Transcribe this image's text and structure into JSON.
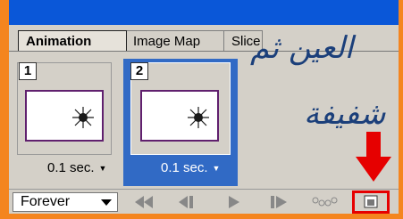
{
  "tabs": [
    "Animation",
    "Image Map",
    "Slice"
  ],
  "frames": [
    {
      "number": "1",
      "delay": "0.1 sec."
    },
    {
      "number": "2",
      "delay": "0.1 sec."
    }
  ],
  "loop": {
    "value": "Forever"
  },
  "annotation": {
    "line1": "العين ثم",
    "line2": "شفيفة"
  },
  "colors": {
    "selection": "#316ac5",
    "panel": "#d4d0c8",
    "highlight_border": "#e60000",
    "annotation_text": "#1b3f7a",
    "frame_border": "#f4851f",
    "titlebar": "#0a57d8"
  },
  "icons": [
    "caret-down-icon",
    "first-frame-icon",
    "previous-frame-icon",
    "play-icon",
    "next-frame-icon",
    "tween-icon",
    "duplicate-frame-icon",
    "red-arrow-down-icon"
  ]
}
